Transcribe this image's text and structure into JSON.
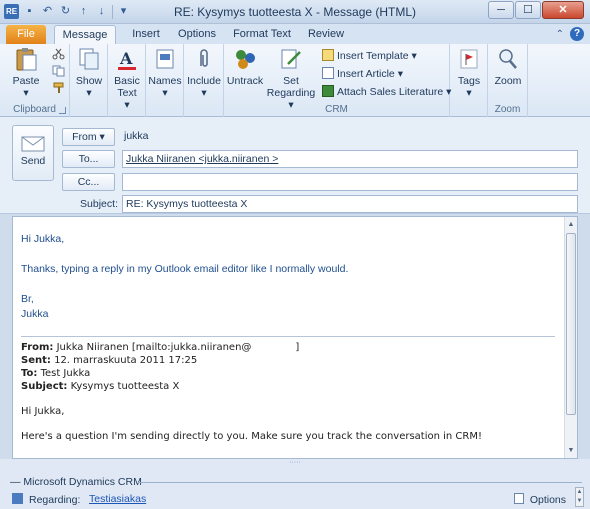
{
  "window": {
    "title": "RE: Kysymys tuotteesta X  -  Message (HTML)",
    "minimize": "─",
    "maximize": "☐",
    "close": "✕"
  },
  "tabs": [
    "File",
    "Message",
    "Insert",
    "Options",
    "Format Text",
    "Review"
  ],
  "ribbon": {
    "clipboard": {
      "paste": "Paste",
      "group": "Clipboard"
    },
    "show": "Show",
    "basic_text": "Basic Text",
    "names": "Names",
    "include": "Include",
    "crm": {
      "untrack": "Untrack",
      "set_regarding": "Set Regarding",
      "insert_template": "Insert Template",
      "insert_article": "Insert Article",
      "attach_sales": "Attach Sales Literature",
      "group": "CRM"
    },
    "tags": "Tags",
    "zoom": {
      "button": "Zoom",
      "group": "Zoom"
    }
  },
  "header": {
    "send": "Send",
    "from_button": "From",
    "from_value": "jukka",
    "to_button": "To...",
    "to_value": "Jukka Niiranen <jukka.niiranen                 >",
    "cc_button": "Cc...",
    "cc_value": "",
    "subject_label": "Subject:",
    "subject_value": "RE: Kysymys tuotteesta X"
  },
  "body": {
    "greeting": "Hi Jukka,",
    "message": "Thanks, typing a reply in my Outlook email editor like I normally would.",
    "closing": "Br,",
    "signature": "Jukka",
    "original": {
      "from_label": "From:",
      "from_value": "Jukka Niiranen [mailto:jukka.niiranen@",
      "from_end": "]",
      "sent_label": "Sent:",
      "sent_value": "12. marraskuuta 2011 17:25",
      "to_label": "To:",
      "to_value": "Test Jukka",
      "subject_label": "Subject:",
      "subject_value": "Kysymys tuotteesta X",
      "greeting": "Hi Jukka,",
      "text": "Here's a question I'm sending directly to you. Make sure you track the conversation in CRM!"
    }
  },
  "crm_pane": {
    "title": "Microsoft Dynamics CRM",
    "regarding_label": "Regarding:",
    "regarding_value": "Testiasiakas",
    "options": "Options"
  },
  "colors": {
    "accent": "#1e395b",
    "file_tab": "#e2821a",
    "link": "#1c56b7",
    "reply_text": "#1f4e8c"
  }
}
